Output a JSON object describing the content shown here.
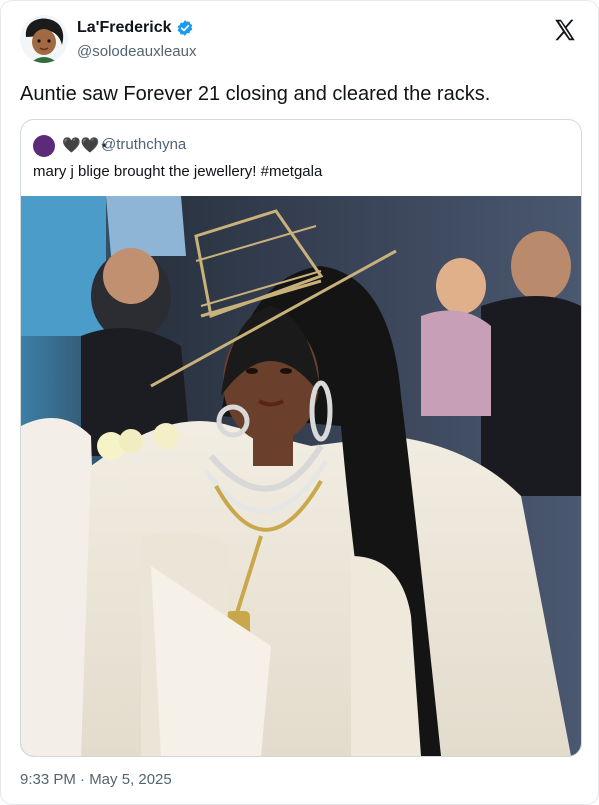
{
  "author": {
    "display_name": "La'Frederick",
    "handle": "@solodeauxleaux"
  },
  "tweet": {
    "text": "Auntie saw Forever 21 closing and cleared the racks.",
    "timestamp": "9:33 PM · May 5, 2025"
  },
  "quoted": {
    "display_name": "🖤🖤⋆",
    "handle": "@truthchyna",
    "text": "mary j blige brought the jewellery! #metgala"
  },
  "icons": {
    "verified": "verified-badge-icon",
    "platform": "x-logo-icon"
  },
  "colors": {
    "verified_blue": "#1d9bf0",
    "secondary_text": "#536471",
    "border": "#cfd9de"
  }
}
